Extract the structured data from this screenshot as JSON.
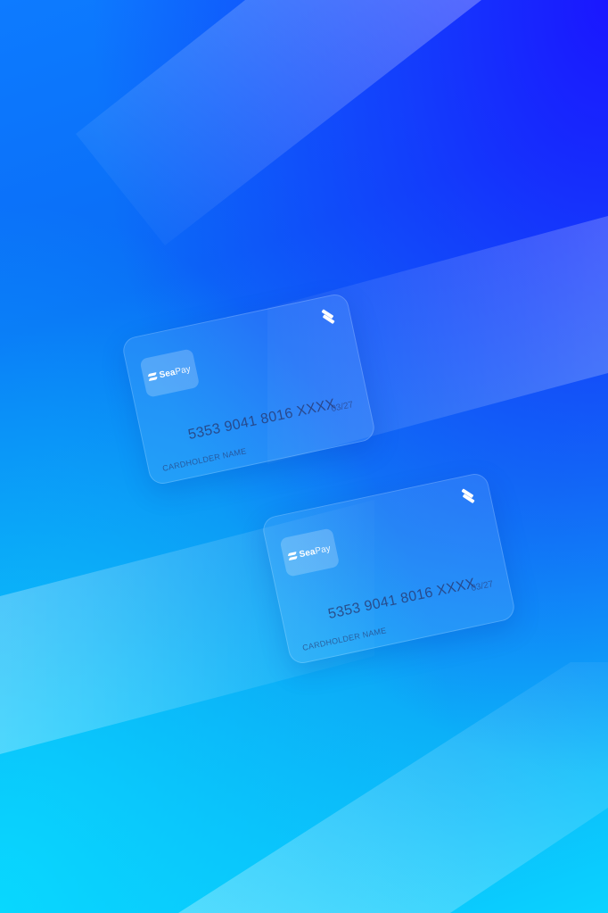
{
  "brand": {
    "name_bold": "Sea",
    "name_light": "Pay",
    "icon": "stripes-icon"
  },
  "cards": [
    {
      "number": "5353 9041 8016 XXXX",
      "expiry": "03/27",
      "holder_label": "CARDHOLDER NAME"
    },
    {
      "number": "5353 9041 8016 XXXX",
      "expiry": "03/27",
      "holder_label": "CARDHOLDER NAME"
    }
  ],
  "colors": {
    "background_top_right": "#1a16ff",
    "background_mid": "#0a6cf6",
    "background_bottom_left": "#0ad3ff",
    "card_fill": "#78b4ff",
    "card_text": "#28376e",
    "logo_text": "#ffffff"
  }
}
